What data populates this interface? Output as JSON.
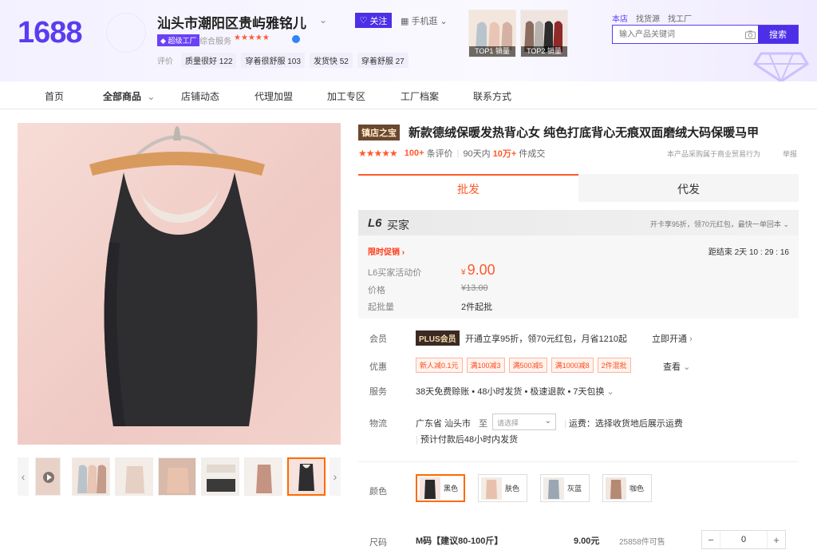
{
  "header": {
    "logo": "1688",
    "shop_name": "汕头市潮阳区贵屿雅铭儿",
    "follow": "关注",
    "mobile": "手机逛",
    "factory_badge": "超级工厂",
    "service_label": "综合服务",
    "service_stars": "★★★★★",
    "eval_label": "评价",
    "eval_chips": [
      "质量很好 122",
      "穿着很舒服 103",
      "发货快 52",
      "穿着舒服 27"
    ],
    "top_products": [
      "TOP1 销量",
      "TOP2 销量"
    ],
    "search_tabs": [
      "本店",
      "找货源",
      "找工厂"
    ],
    "search_placeholder": "输入产品关键词",
    "search_button": "搜索"
  },
  "nav": [
    "首页",
    "全部商品",
    "店铺动态",
    "代理加盟",
    "加工专区",
    "工厂档案",
    "联系方式"
  ],
  "product": {
    "store_tag": "镇店之宝",
    "title": "新款德绒保暖发热背心女 纯色打底背心无痕双面磨绒大码保暖马甲",
    "rating_stars": "★★★★★",
    "review_count": "100+",
    "review_label": "条评价",
    "days": "90天内",
    "sold": "10万+",
    "sold_label": "件成交",
    "buyer_note": "本产品采购属于商业贸易行为",
    "report": "举报"
  },
  "tabs": [
    "批发",
    "代发"
  ],
  "price_panel": {
    "level": "L6",
    "level_text": "买家",
    "offer": "开卡享95折，领70元红包，最快一单回本",
    "promo": "限时促销",
    "countdown": "距结束  2天 10 : 29 : 16",
    "activity_label": "L6买家活动价",
    "currency": "¥",
    "activity_price": "9.00",
    "price_label": "价格",
    "original_price": "¥13.00",
    "moq_label": "起批量",
    "moq": "2件起批"
  },
  "member": {
    "label": "会员",
    "badge": "PLUS会员",
    "text": "开通立享95折，领70元红包，月省1210起",
    "open": "立即开通"
  },
  "coupons": {
    "label": "优惠",
    "items": [
      "新人减0.1元",
      "满100减3",
      "满500减5",
      "满1000减8",
      "2件混批"
    ],
    "see": "查看"
  },
  "service": {
    "label": "服务",
    "text": "38天免费赊账 • 48小时发货 • 极速退款 • 7天包换"
  },
  "logistics": {
    "label": "物流",
    "from": "广东省 汕头市",
    "to": "至",
    "select_placeholder": "请选择",
    "freight": "运费：选择收货地后展示运费",
    "ship_note": "预计付款后48小时内发货"
  },
  "colors": {
    "label": "颜色",
    "options": [
      {
        "name": "黑色",
        "swatch": "#2a2a2a"
      },
      {
        "name": "肤色",
        "swatch": "#e8c1ad"
      },
      {
        "name": "灰蓝",
        "swatch": "#9aa7b3"
      },
      {
        "name": "咖色",
        "swatch": "#b58a72"
      }
    ]
  },
  "size": {
    "label": "尺码",
    "name": "M码【建议80-100斤】",
    "price": "9.00元",
    "stock": "25858件可售",
    "qty": "0"
  },
  "colors_accent": {
    "brand": "#5a3df0",
    "price": "#ff5a2c"
  }
}
